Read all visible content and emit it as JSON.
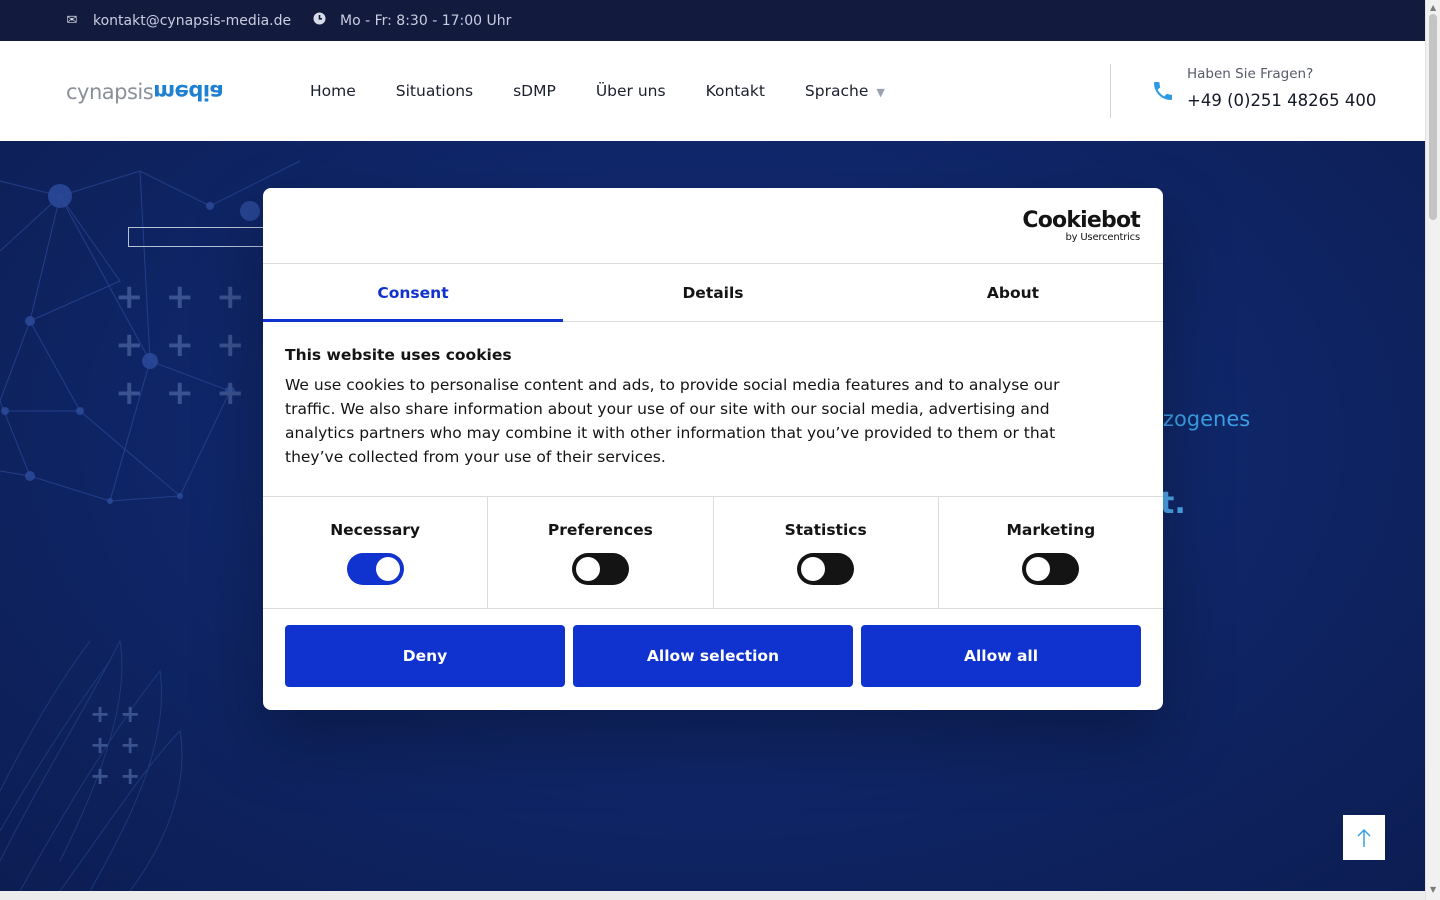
{
  "topbar": {
    "email": "kontakt@cynapsis-media.de",
    "hours": "Mo - Fr: 8:30 - 17:00 Uhr",
    "email_icon": "envelope-icon",
    "hours_icon": "clock-icon"
  },
  "header": {
    "logo_left": "cynapsis",
    "logo_right": "media",
    "nav": [
      "Home",
      "Situations",
      "sDMP",
      "Über uns",
      "Kontakt",
      "Sprache"
    ],
    "phone_question": "Haben Sie Fragen?",
    "phone_number": "+49 (0)251 48265 400",
    "phone_icon": "phone-icon"
  },
  "hero": {
    "text_partial_1": "ezogenes",
    "text_partial_2": "t."
  },
  "cookie_dialog": {
    "brand": "Cookiebot",
    "brand_sub": "by Usercentrics",
    "tabs": [
      "Consent",
      "Details",
      "About"
    ],
    "active_tab": "Consent",
    "title": "This website uses cookies",
    "description": "We use cookies to personalise content and ads, to provide social media features and to analyse our traffic. We also share information about your use of our site with our social media, advertising and analytics partners who may combine it with other information that you’ve provided to them or that they’ve collected from your use of their services.",
    "toggles": [
      {
        "label": "Necessary",
        "on": true
      },
      {
        "label": "Preferences",
        "on": false
      },
      {
        "label": "Statistics",
        "on": false
      },
      {
        "label": "Marketing",
        "on": false
      }
    ],
    "buttons": {
      "deny": "Deny",
      "allow_selection": "Allow selection",
      "allow_all": "Allow all"
    },
    "accent_color": "#1032cf"
  },
  "colors": {
    "topbar_bg": "#121a3e",
    "hero_bg": "#0f2566",
    "hero_accent": "#3c9fe6"
  }
}
